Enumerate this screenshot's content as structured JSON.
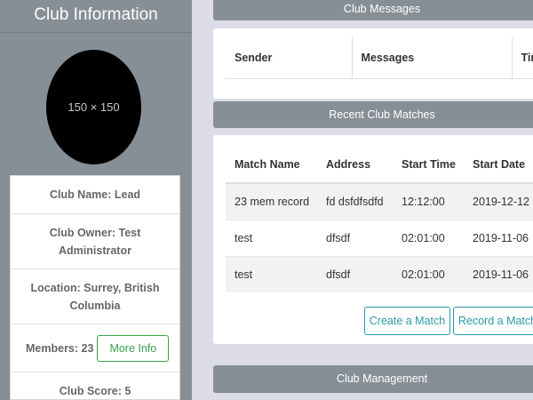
{
  "sidebar": {
    "title": "Club Information",
    "avatar_placeholder": "150 × 150",
    "club_name": "Club Name: Lead",
    "club_owner": "Club Owner: Test Administrator",
    "location": "Location: Surrey, British Columbia",
    "members": "Members: 23",
    "more_info_label": "More Info",
    "club_score": "Club Score: 5"
  },
  "messages": {
    "header": "Club Messages",
    "columns": [
      "Sender",
      "Messages",
      "Tim"
    ]
  },
  "matches": {
    "header": "Recent Club Matches",
    "columns": [
      "Match Name",
      "Address",
      "Start Time",
      "Start Date"
    ],
    "rows": [
      [
        "23 mem record",
        "fd dsfdfsdfd",
        "12:12:00",
        "2019-12-12"
      ],
      [
        "test",
        "dfsdf",
        "02:01:00",
        "2019-11-06"
      ],
      [
        "test",
        "dfsdf",
        "02:01:00",
        "2019-11-06"
      ]
    ],
    "create_label": "Create a Match",
    "record_label": "Record a Match"
  },
  "management": {
    "header": "Club Management"
  },
  "colors": {
    "sidebar_bg": "#878f96",
    "page_bg": "#dcdce8",
    "success": "#3aa04a",
    "info": "#2a9aa8"
  }
}
